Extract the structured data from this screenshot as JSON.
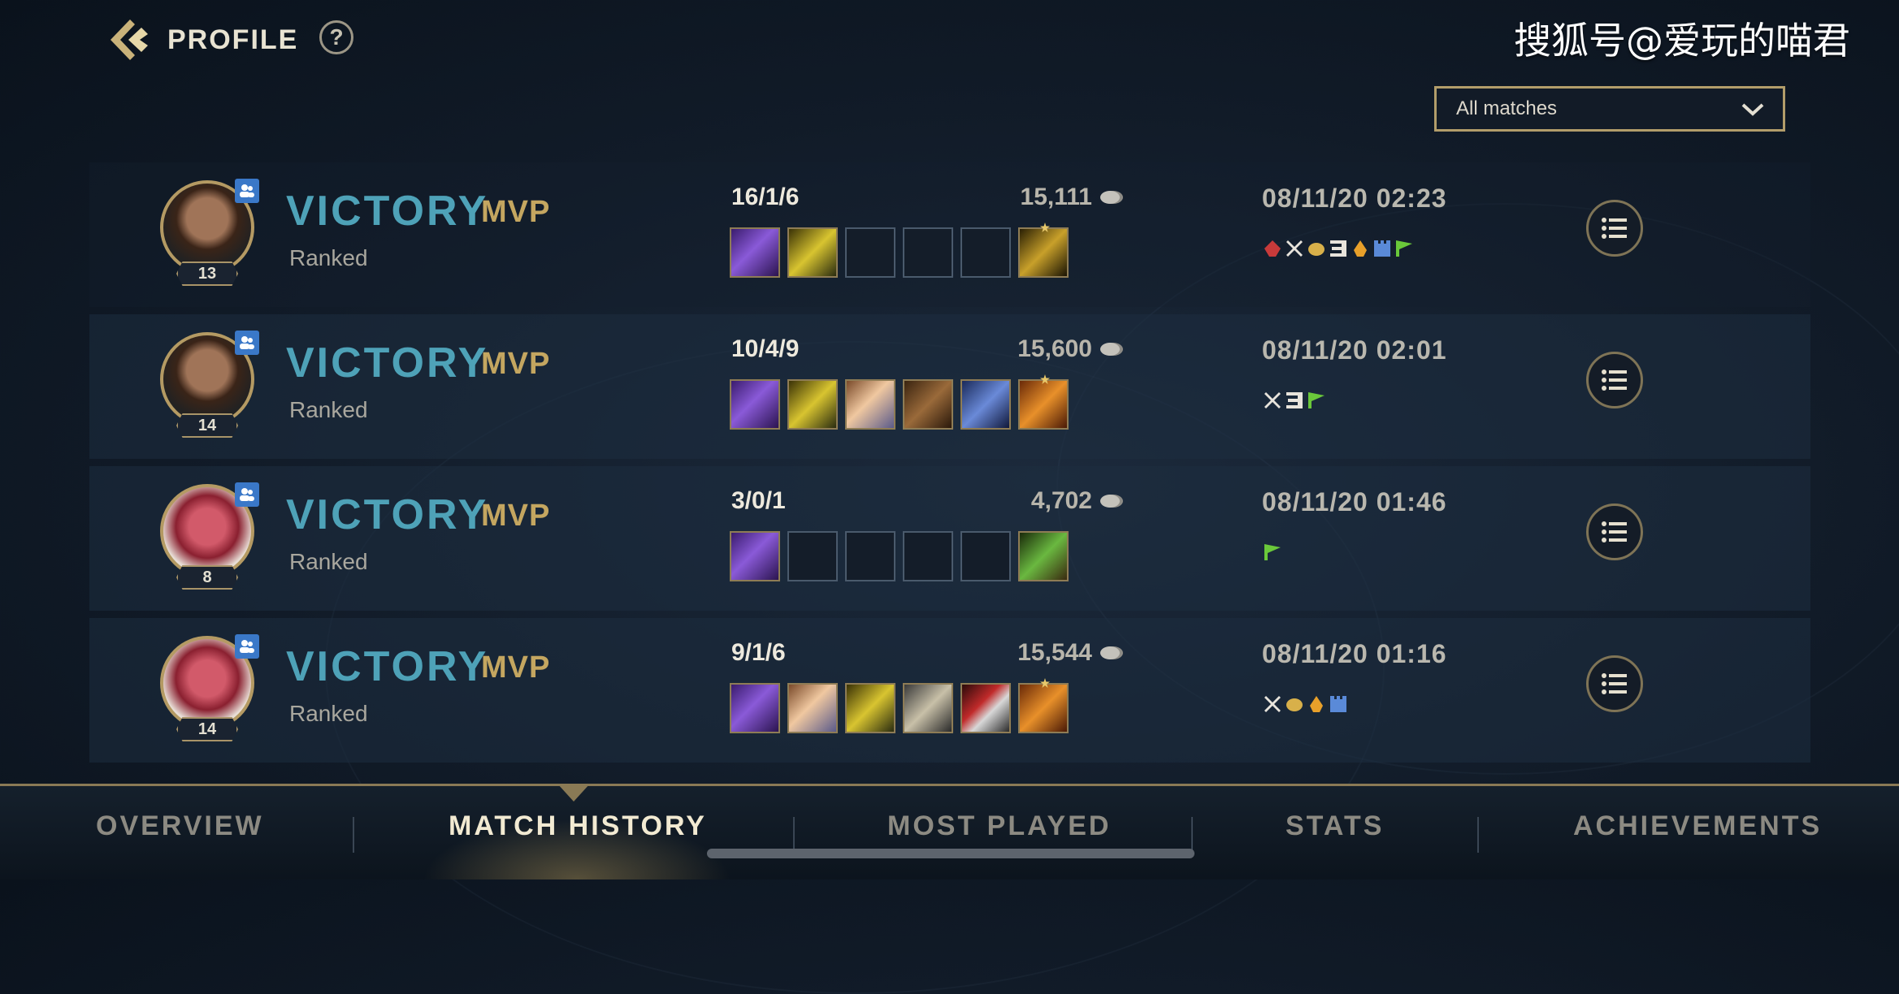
{
  "header": {
    "title": "PROFILE",
    "help_label": "?"
  },
  "watermark": "搜狐号@爱玩的喵君",
  "filter": {
    "value": "All matches"
  },
  "colors": {
    "victory": "#4ea2b8",
    "mvp": "#c4a660",
    "accent_gold": "#b29d6a"
  },
  "matches": [
    {
      "result": "VICTORY",
      "mvp": "MVP",
      "mode": "Ranked",
      "level": "13",
      "hero_icon": "hero-portrait-a",
      "kda": "16/1/6",
      "gold": "15,111",
      "time": "08/11/20 02:23",
      "items": [
        "purple-sword-item",
        "gold-triangle-item",
        "empty",
        "empty",
        "empty",
        "boots-item-starred"
      ],
      "achievements": [
        "red-blade-icon",
        "crossed-swords-icon",
        "coins-icon",
        "triple-kill-icon",
        "flame-icon",
        "tower-icon",
        "flag-icon"
      ]
    },
    {
      "result": "VICTORY",
      "mvp": "MVP",
      "mode": "Ranked",
      "level": "14",
      "hero_icon": "hero-portrait-a",
      "kda": "10/4/9",
      "gold": "15,600",
      "time": "08/11/20 02:01",
      "items": [
        "purple-sword-item",
        "gold-triangle-item",
        "winged-blade-item",
        "armor-item",
        "chainmail-item",
        "phoenix-item-starred"
      ],
      "achievements": [
        "crossed-swords-icon",
        "triple-kill-icon",
        "flag-icon"
      ]
    },
    {
      "result": "VICTORY",
      "mvp": "MVP",
      "mode": "Ranked",
      "level": "8",
      "hero_icon": "hero-portrait-b",
      "kda": "3/0/1",
      "gold": "4,702",
      "time": "08/11/20 01:46",
      "items": [
        "purple-sword-item",
        "empty",
        "empty",
        "empty",
        "empty",
        "green-boots-item"
      ],
      "achievements": [
        "flag-icon"
      ]
    },
    {
      "result": "VICTORY",
      "mvp": "MVP",
      "mode": "Ranked",
      "level": "14",
      "hero_icon": "hero-portrait-b",
      "kda": "9/1/6",
      "gold": "15,544",
      "time": "08/11/20 01:16",
      "items": [
        "purple-sword-item",
        "winged-blade-item",
        "gold-triangle-item",
        "belt-item",
        "shield-item",
        "phoenix-item-starred"
      ],
      "achievements": [
        "crossed-swords-icon",
        "coins-icon",
        "flame-icon",
        "tower-icon"
      ]
    }
  ],
  "nav": {
    "tabs": [
      "OVERVIEW",
      "MATCH HISTORY",
      "MOST PLAYED",
      "STATS",
      "ACHIEVEMENTS"
    ],
    "active": "MATCH HISTORY"
  }
}
